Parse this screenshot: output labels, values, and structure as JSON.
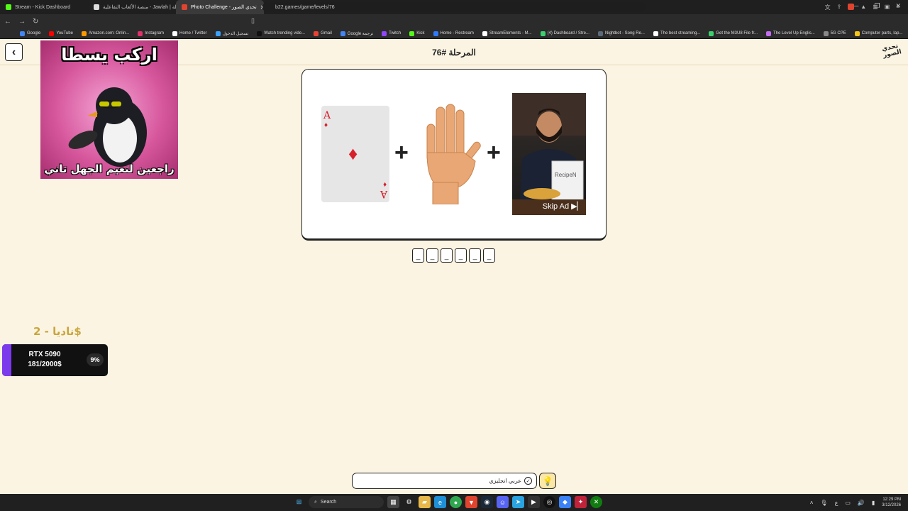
{
  "browser": {
    "tabs": [
      {
        "label": "Stream - Kick Dashboard",
        "active": false,
        "color": "#53fc18"
      },
      {
        "label": "جولة | Jawlah - منصة الألعاب التفاعلية",
        "active": false,
        "color": "#ffffff"
      },
      {
        "label": "Photo Challenge - تحدي الصور",
        "active": true,
        "color": "#e0442f"
      }
    ],
    "url": "b22.games/game/levels/76",
    "bookmarks": [
      {
        "label": "Google",
        "color": "#4285f4"
      },
      {
        "label": "YouTube",
        "color": "#ff0000"
      },
      {
        "label": "Amazon.com: Onlin...",
        "color": "#ff9900"
      },
      {
        "label": "Instagram",
        "color": "#e1306c"
      },
      {
        "label": "Home / Twitter",
        "color": "#ffffff"
      },
      {
        "label": "تسجيل الدخول",
        "color": "#3aa3ff"
      },
      {
        "label": "Watch trending vide...",
        "color": "#111111"
      },
      {
        "label": "Gmail",
        "color": "#ea4335"
      },
      {
        "label": "Google ترجمة",
        "color": "#4285f4"
      },
      {
        "label": "Twitch",
        "color": "#9146ff"
      },
      {
        "label": "Kick",
        "color": "#53fc18"
      },
      {
        "label": "Home - Restream",
        "color": "#2f7bff"
      },
      {
        "label": "StreamElements - M...",
        "color": "#ffffff"
      },
      {
        "label": "(4) Dashboard / Stre...",
        "color": "#3bd16f"
      },
      {
        "label": "Nightbot - Song Re...",
        "color": "#5b6b7b"
      },
      {
        "label": "The best streaming...",
        "color": "#ffffff"
      },
      {
        "label": "Get the M3U8 File fr...",
        "color": "#3bd16f"
      },
      {
        "label": "The Level Up Englis...",
        "color": "#c46cf2"
      },
      {
        "label": "5G CPE",
        "color": "#888888"
      },
      {
        "label": "Computer parts, lap...",
        "color": "#f5c518"
      }
    ]
  },
  "game": {
    "level_title": "المرحلة #76",
    "logo_line1": "تحدي",
    "logo_line2": "الصور",
    "back_icon": "chevron-left-icon",
    "puzzle": {
      "card_rank": "A",
      "card_suit": "♦",
      "skip_ad": "Skip Ad"
    },
    "answer_slots": [
      "_",
      "_",
      "_",
      "_",
      "_",
      "_"
    ],
    "hint_text": "عربي انجليزي",
    "hint_icon": "lightbulb-icon"
  },
  "overlay": {
    "meme_top": "اركب يسطا",
    "meme_bottom": "راجعين لنعيم الجهل تاني",
    "donor": "ناديا - 2$",
    "goal_name": "RTX 5090",
    "goal_amount": "181/2000$",
    "goal_percent": "9%",
    "goal_fraction": 0.09,
    "goal_color": "#7c3aed"
  },
  "taskbar": {
    "search": "Search",
    "lang": "ع",
    "time": "12:29 PM",
    "date": "3/12/2026"
  }
}
